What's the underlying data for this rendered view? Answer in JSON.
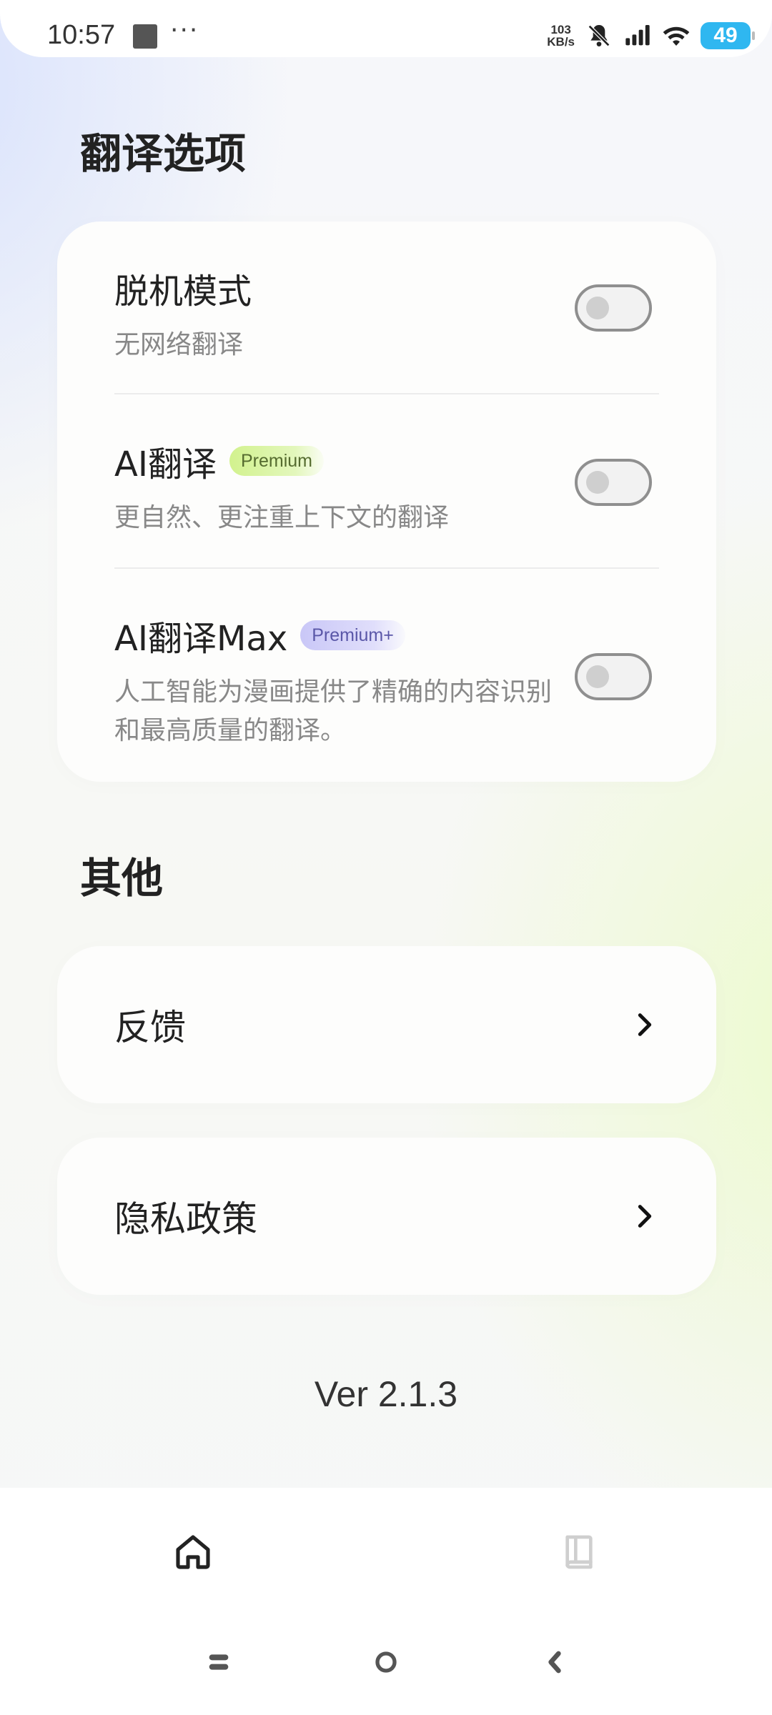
{
  "status_bar": {
    "time": "10:57",
    "dots": "···",
    "net_speed_value": "103",
    "net_speed_unit": "KB/s",
    "battery": "49",
    "icons": [
      "notifications-off-icon",
      "signal-icon",
      "wifi-icon",
      "battery-icon"
    ]
  },
  "translation_section": {
    "title": "翻译选项",
    "items": [
      {
        "title": "脱机模式",
        "description": "无网络翻译",
        "badge": "",
        "enabled": false
      },
      {
        "title": "AI翻译",
        "description": "更自然、更注重上下文的翻译",
        "badge": "Premium",
        "enabled": false
      },
      {
        "title": "AI翻译Max",
        "description": "人工智能为漫画提供了精确的内容识别和最高质量的翻译。",
        "badge": "Premium+",
        "enabled": false
      }
    ]
  },
  "other_section": {
    "title": "其他",
    "links": [
      {
        "label": "反馈"
      },
      {
        "label": "隐私政策"
      }
    ]
  },
  "version": "Ver 2.1.3",
  "bottom_nav": {
    "items": [
      {
        "icon": "home-icon",
        "active": true
      },
      {
        "icon": "book-icon",
        "active": false
      }
    ]
  },
  "system_nav": [
    "recents-icon",
    "home-circle-icon",
    "back-icon"
  ],
  "colors": {
    "premium_badge": "#d2f28e",
    "premium_plus_badge": "#c9c7f7",
    "battery": "#2fb7f0",
    "active_nav": "#222222",
    "inactive_nav": "#cfcfcf"
  }
}
